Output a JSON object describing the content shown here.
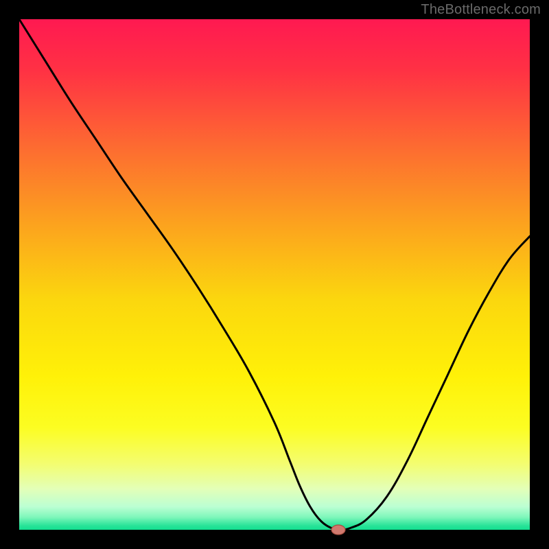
{
  "watermark": "TheBottleneck.com",
  "chart_data": {
    "type": "line",
    "title": "",
    "xlabel": "",
    "ylabel": "",
    "xlim": [
      0,
      100
    ],
    "ylim": [
      0,
      100
    ],
    "grid": false,
    "background_gradient": {
      "type": "vertical",
      "stops": [
        {
          "offset": 0.0,
          "color": "#ff1951"
        },
        {
          "offset": 0.1,
          "color": "#ff3144"
        },
        {
          "offset": 0.25,
          "color": "#fd6b31"
        },
        {
          "offset": 0.4,
          "color": "#fca21e"
        },
        {
          "offset": 0.55,
          "color": "#fbd70e"
        },
        {
          "offset": 0.7,
          "color": "#fff108"
        },
        {
          "offset": 0.8,
          "color": "#fcfd22"
        },
        {
          "offset": 0.87,
          "color": "#f4fd6f"
        },
        {
          "offset": 0.92,
          "color": "#e3ffb8"
        },
        {
          "offset": 0.955,
          "color": "#bbffd3"
        },
        {
          "offset": 0.975,
          "color": "#7ff7bb"
        },
        {
          "offset": 0.992,
          "color": "#28e398"
        },
        {
          "offset": 1.0,
          "color": "#13df90"
        }
      ]
    },
    "border_color": "#000000",
    "series": [
      {
        "name": "bottleneck-curve",
        "color": "#000000",
        "width": 3,
        "x": [
          0.0,
          5.0,
          10.0,
          15.0,
          20.0,
          25.0,
          30.0,
          35.0,
          40.0,
          45.0,
          50.0,
          53.0,
          55.0,
          57.0,
          59.0,
          61.0,
          63.0,
          65.0,
          68.0,
          72.0,
          76.0,
          80.0,
          84.0,
          88.0,
          92.0,
          96.0,
          100.0
        ],
        "y": [
          100.0,
          92.0,
          84.0,
          76.5,
          69.0,
          62.0,
          55.0,
          47.5,
          39.5,
          31.0,
          21.0,
          13.5,
          8.5,
          4.5,
          1.8,
          0.4,
          0.0,
          0.4,
          2.0,
          6.5,
          13.5,
          22.0,
          30.5,
          39.0,
          46.5,
          53.0,
          57.5
        ]
      }
    ],
    "marker": {
      "name": "optimal-point",
      "x": 62.5,
      "y": 0.0,
      "color_fill": "#d0796e",
      "color_stroke": "#a84d3f",
      "rx": 10,
      "ry": 7
    }
  }
}
